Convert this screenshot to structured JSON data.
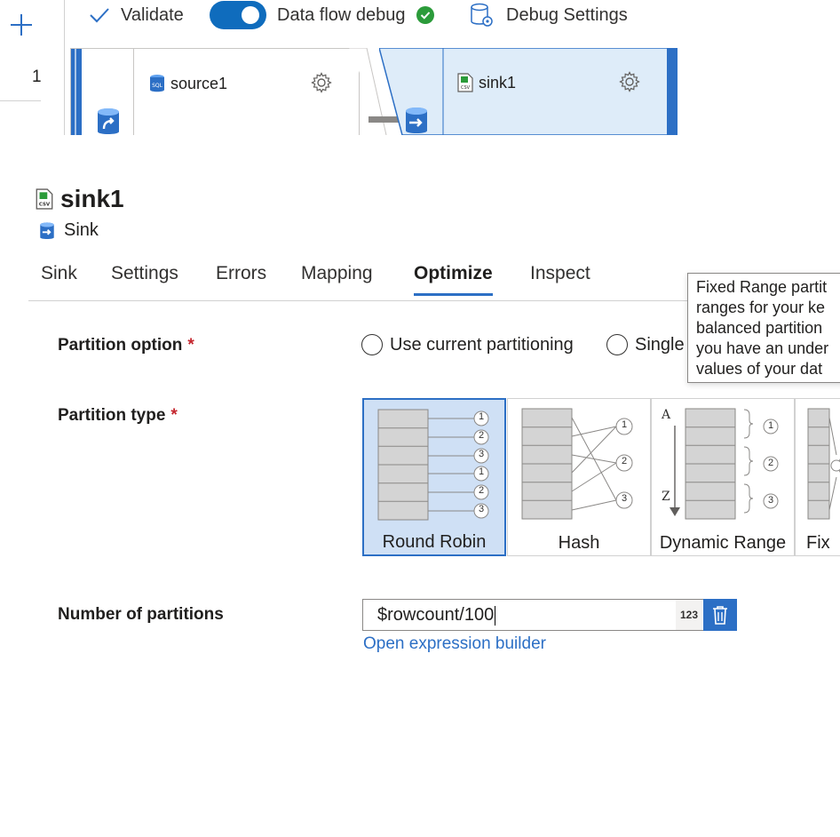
{
  "toolbar": {
    "validate_label": "Validate",
    "debug_label": "Data flow debug",
    "debug_on": true,
    "debug_settings_label": "Debug Settings"
  },
  "gutter": {
    "add_icon": "plus-icon",
    "page_number": "1"
  },
  "graph": {
    "source_node": {
      "name": "source1",
      "icon": "sql-database-icon"
    },
    "sink_node": {
      "name": "sink1",
      "icon": "csv-file-icon"
    }
  },
  "panel": {
    "title": "sink1",
    "subtitle": "Sink",
    "tabs": [
      "Sink",
      "Settings",
      "Errors",
      "Mapping",
      "Optimize",
      "Inspect"
    ],
    "active_tab": "Optimize"
  },
  "tooltip": {
    "lines": [
      "Fixed Range partit",
      "ranges for your ke",
      "balanced partition",
      "you have an under",
      "values of your dat"
    ]
  },
  "partition_option": {
    "label": "Partition option",
    "required_mark": "*",
    "options": [
      "Use current partitioning",
      "Single"
    ]
  },
  "partition_type": {
    "label": "Partition type",
    "required_mark": "*",
    "types": [
      "Round Robin",
      "Hash",
      "Dynamic Range",
      "Fix"
    ],
    "selected": "Round Robin",
    "diagram_numbers": [
      "1",
      "2",
      "3",
      "1",
      "2",
      "3"
    ],
    "range_letters": [
      "A",
      "Z"
    ]
  },
  "num_partitions": {
    "label": "Number of partitions",
    "value": "$rowcount/100",
    "type_tag": "123",
    "link": "Open expression builder"
  },
  "colors": {
    "accent": "#2c6fc5",
    "success": "#2b9b3a",
    "required": "#c4262e",
    "selected_bg": "#cfe0f5"
  }
}
